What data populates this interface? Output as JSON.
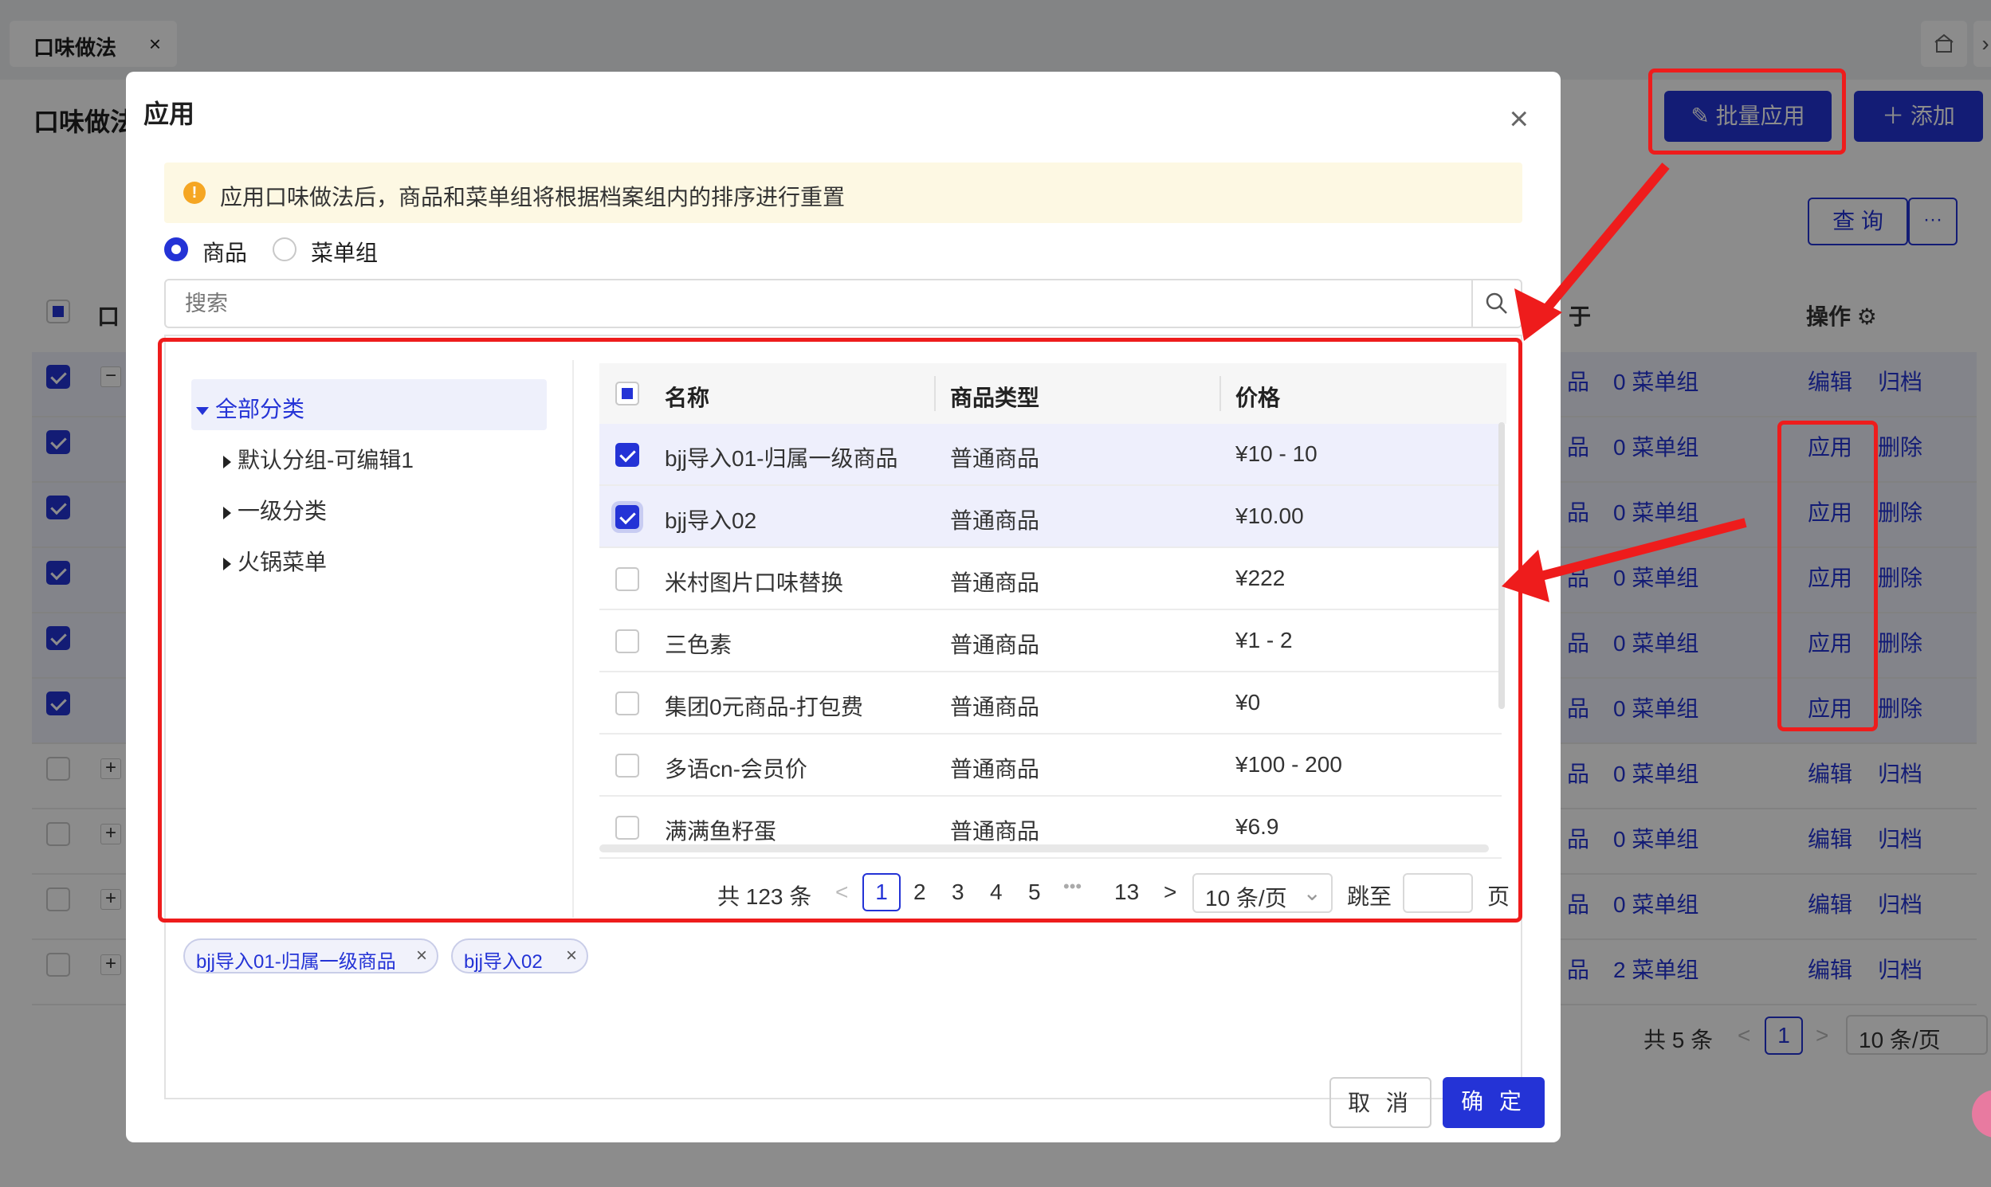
{
  "background": {
    "tab": {
      "label": "口味做法",
      "close": "×"
    },
    "title": "口味做法",
    "batch_apply_label": "批量应用",
    "add_label": "添加",
    "query_label": "查 询",
    "more_label": "···",
    "col_partial": "于",
    "ops_header": "操作",
    "rows": [
      {
        "checked": true,
        "expand": "−",
        "c1": "品",
        "c2": "0 菜单组",
        "a1": "编辑",
        "a2": "归档"
      },
      {
        "checked": true,
        "expand": "",
        "c1": "品",
        "c2": "0 菜单组",
        "a1": "应用",
        "a2": "删除"
      },
      {
        "checked": true,
        "expand": "",
        "c1": "品",
        "c2": "0 菜单组",
        "a1": "应用",
        "a2": "删除"
      },
      {
        "checked": true,
        "expand": "",
        "c1": "品",
        "c2": "0 菜单组",
        "a1": "应用",
        "a2": "删除"
      },
      {
        "checked": true,
        "expand": "",
        "c1": "品",
        "c2": "0 菜单组",
        "a1": "应用",
        "a2": "删除"
      },
      {
        "checked": true,
        "expand": "",
        "c1": "品",
        "c2": "0 菜单组",
        "a1": "应用",
        "a2": "删除"
      },
      {
        "checked": false,
        "expand": "+",
        "c1": "品",
        "c2": "0 菜单组",
        "a1": "编辑",
        "a2": "归档"
      },
      {
        "checked": false,
        "expand": "+",
        "c1": "品",
        "c2": "0 菜单组",
        "a1": "编辑",
        "a2": "归档"
      },
      {
        "checked": false,
        "expand": "+",
        "c1": "品",
        "c2": "0 菜单组",
        "a1": "编辑",
        "a2": "归档"
      },
      {
        "checked": false,
        "expand": "+",
        "c1": "品",
        "c2": "2 菜单组",
        "a1": "编辑",
        "a2": "归档"
      }
    ],
    "pagination": {
      "total": "共 5 条",
      "current": "1",
      "page_size": "10 条/页"
    }
  },
  "modal": {
    "title": "应用",
    "close": "×",
    "alert_icon": "!",
    "alert_text": "应用口味做法后，商品和菜单组将根据档案组内的排序进行重置",
    "radio_goods": "商品",
    "radio_menu": "菜单组",
    "search_placeholder": "搜索",
    "tree": {
      "root": "全部分类",
      "children": [
        "默认分组-可编辑1",
        "一级分类",
        "火锅菜单"
      ]
    },
    "table": {
      "headers": [
        "名称",
        "商品类型",
        "价格"
      ],
      "rows": [
        {
          "checked": true,
          "name": "bjj导入01-归属一级商品",
          "type": "普通商品",
          "price": "¥10 - 10"
        },
        {
          "checked": true,
          "name": "bjj导入02",
          "type": "普通商品",
          "price": "¥10.00"
        },
        {
          "checked": false,
          "name": "米村图片口味替换",
          "type": "普通商品",
          "price": "¥222"
        },
        {
          "checked": false,
          "name": "三色素",
          "type": "普通商品",
          "price": "¥1 - 2"
        },
        {
          "checked": false,
          "name": "集团0元商品-打包费",
          "type": "普通商品",
          "price": "¥0"
        },
        {
          "checked": false,
          "name": "多语cn-会员价",
          "type": "普通商品",
          "price": "¥100 - 200"
        },
        {
          "checked": false,
          "name": "满满鱼籽蛋",
          "type": "普通商品",
          "price": "¥6.9"
        }
      ]
    },
    "pagination": {
      "total": "共 123 条",
      "prev": "<",
      "pages": [
        "1",
        "2",
        "3",
        "4",
        "5"
      ],
      "ellipsis": "•••",
      "last": "13",
      "next": ">",
      "page_size": "10 条/页",
      "jump_label": "跳至",
      "page_suffix": "页"
    },
    "selected_tags": [
      "bjj导入01-归属一级商品",
      "bjj导入02"
    ],
    "cancel_label": "取 消",
    "ok_label": "确 定"
  },
  "colors": {
    "primary": "#2433d6",
    "annotation": "#ee1c1c",
    "alert_bg": "#fdf8e3",
    "warning": "#f5a623"
  }
}
